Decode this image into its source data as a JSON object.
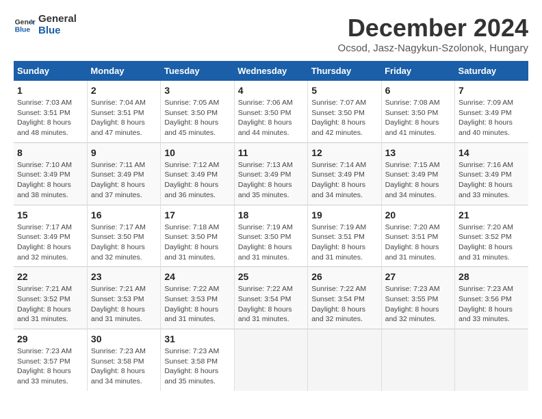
{
  "logo": {
    "name1": "General",
    "name2": "Blue"
  },
  "title": "December 2024",
  "subtitle": "Ocsod, Jasz-Nagykun-Szolonk, Hungary",
  "weekdays": [
    "Sunday",
    "Monday",
    "Tuesday",
    "Wednesday",
    "Thursday",
    "Friday",
    "Saturday"
  ],
  "weeks": [
    [
      {
        "day": "1",
        "sunrise": "7:03 AM",
        "sunset": "3:51 PM",
        "daylight": "8 hours and 48 minutes."
      },
      {
        "day": "2",
        "sunrise": "7:04 AM",
        "sunset": "3:51 PM",
        "daylight": "8 hours and 47 minutes."
      },
      {
        "day": "3",
        "sunrise": "7:05 AM",
        "sunset": "3:50 PM",
        "daylight": "8 hours and 45 minutes."
      },
      {
        "day": "4",
        "sunrise": "7:06 AM",
        "sunset": "3:50 PM",
        "daylight": "8 hours and 44 minutes."
      },
      {
        "day": "5",
        "sunrise": "7:07 AM",
        "sunset": "3:50 PM",
        "daylight": "8 hours and 42 minutes."
      },
      {
        "day": "6",
        "sunrise": "7:08 AM",
        "sunset": "3:50 PM",
        "daylight": "8 hours and 41 minutes."
      },
      {
        "day": "7",
        "sunrise": "7:09 AM",
        "sunset": "3:49 PM",
        "daylight": "8 hours and 40 minutes."
      }
    ],
    [
      {
        "day": "8",
        "sunrise": "7:10 AM",
        "sunset": "3:49 PM",
        "daylight": "8 hours and 38 minutes."
      },
      {
        "day": "9",
        "sunrise": "7:11 AM",
        "sunset": "3:49 PM",
        "daylight": "8 hours and 37 minutes."
      },
      {
        "day": "10",
        "sunrise": "7:12 AM",
        "sunset": "3:49 PM",
        "daylight": "8 hours and 36 minutes."
      },
      {
        "day": "11",
        "sunrise": "7:13 AM",
        "sunset": "3:49 PM",
        "daylight": "8 hours and 35 minutes."
      },
      {
        "day": "12",
        "sunrise": "7:14 AM",
        "sunset": "3:49 PM",
        "daylight": "8 hours and 34 minutes."
      },
      {
        "day": "13",
        "sunrise": "7:15 AM",
        "sunset": "3:49 PM",
        "daylight": "8 hours and 34 minutes."
      },
      {
        "day": "14",
        "sunrise": "7:16 AM",
        "sunset": "3:49 PM",
        "daylight": "8 hours and 33 minutes."
      }
    ],
    [
      {
        "day": "15",
        "sunrise": "7:17 AM",
        "sunset": "3:49 PM",
        "daylight": "8 hours and 32 minutes."
      },
      {
        "day": "16",
        "sunrise": "7:17 AM",
        "sunset": "3:50 PM",
        "daylight": "8 hours and 32 minutes."
      },
      {
        "day": "17",
        "sunrise": "7:18 AM",
        "sunset": "3:50 PM",
        "daylight": "8 hours and 31 minutes."
      },
      {
        "day": "18",
        "sunrise": "7:19 AM",
        "sunset": "3:50 PM",
        "daylight": "8 hours and 31 minutes."
      },
      {
        "day": "19",
        "sunrise": "7:19 AM",
        "sunset": "3:51 PM",
        "daylight": "8 hours and 31 minutes."
      },
      {
        "day": "20",
        "sunrise": "7:20 AM",
        "sunset": "3:51 PM",
        "daylight": "8 hours and 31 minutes."
      },
      {
        "day": "21",
        "sunrise": "7:20 AM",
        "sunset": "3:52 PM",
        "daylight": "8 hours and 31 minutes."
      }
    ],
    [
      {
        "day": "22",
        "sunrise": "7:21 AM",
        "sunset": "3:52 PM",
        "daylight": "8 hours and 31 minutes."
      },
      {
        "day": "23",
        "sunrise": "7:21 AM",
        "sunset": "3:53 PM",
        "daylight": "8 hours and 31 minutes."
      },
      {
        "day": "24",
        "sunrise": "7:22 AM",
        "sunset": "3:53 PM",
        "daylight": "8 hours and 31 minutes."
      },
      {
        "day": "25",
        "sunrise": "7:22 AM",
        "sunset": "3:54 PM",
        "daylight": "8 hours and 31 minutes."
      },
      {
        "day": "26",
        "sunrise": "7:22 AM",
        "sunset": "3:54 PM",
        "daylight": "8 hours and 32 minutes."
      },
      {
        "day": "27",
        "sunrise": "7:23 AM",
        "sunset": "3:55 PM",
        "daylight": "8 hours and 32 minutes."
      },
      {
        "day": "28",
        "sunrise": "7:23 AM",
        "sunset": "3:56 PM",
        "daylight": "8 hours and 33 minutes."
      }
    ],
    [
      {
        "day": "29",
        "sunrise": "7:23 AM",
        "sunset": "3:57 PM",
        "daylight": "8 hours and 33 minutes."
      },
      {
        "day": "30",
        "sunrise": "7:23 AM",
        "sunset": "3:58 PM",
        "daylight": "8 hours and 34 minutes."
      },
      {
        "day": "31",
        "sunrise": "7:23 AM",
        "sunset": "3:58 PM",
        "daylight": "8 hours and 35 minutes."
      },
      null,
      null,
      null,
      null
    ]
  ],
  "labels": {
    "sunrise": "Sunrise:",
    "sunset": "Sunset:",
    "daylight": "Daylight:"
  }
}
